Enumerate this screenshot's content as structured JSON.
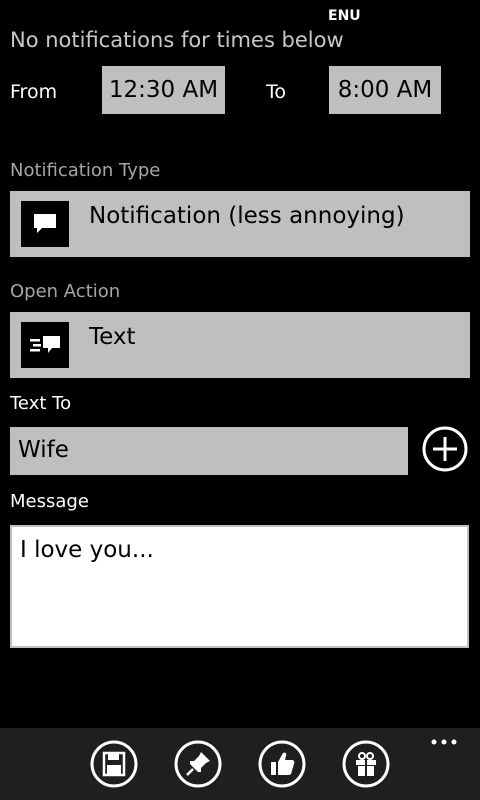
{
  "status": {
    "language": "ENU"
  },
  "header": {
    "no_notifications_text": "No notifications for times below"
  },
  "time_range": {
    "from_label": "From",
    "from_value": "12:30 AM",
    "to_label": "To",
    "to_value": "8:00 AM"
  },
  "notification_type": {
    "label": "Notification Type",
    "value": "Notification (less annoying)",
    "icon": "speech-bubble-icon"
  },
  "open_action": {
    "label": "Open Action",
    "value": "Text",
    "icon": "text-message-icon"
  },
  "text_to": {
    "label": "Text To",
    "value": "Wife",
    "add_icon": "add-circle-icon"
  },
  "message": {
    "label": "Message",
    "value": "I love you..."
  },
  "app_bar": {
    "buttons": [
      "save-icon",
      "pin-icon",
      "thumbs-up-icon",
      "gift-icon"
    ],
    "more_icon": "ellipsis-icon"
  },
  "colors": {
    "background": "#000000",
    "field": "#bfbfbf",
    "appbar": "#1f1f1f",
    "label_dim": "#a6a6a6"
  }
}
